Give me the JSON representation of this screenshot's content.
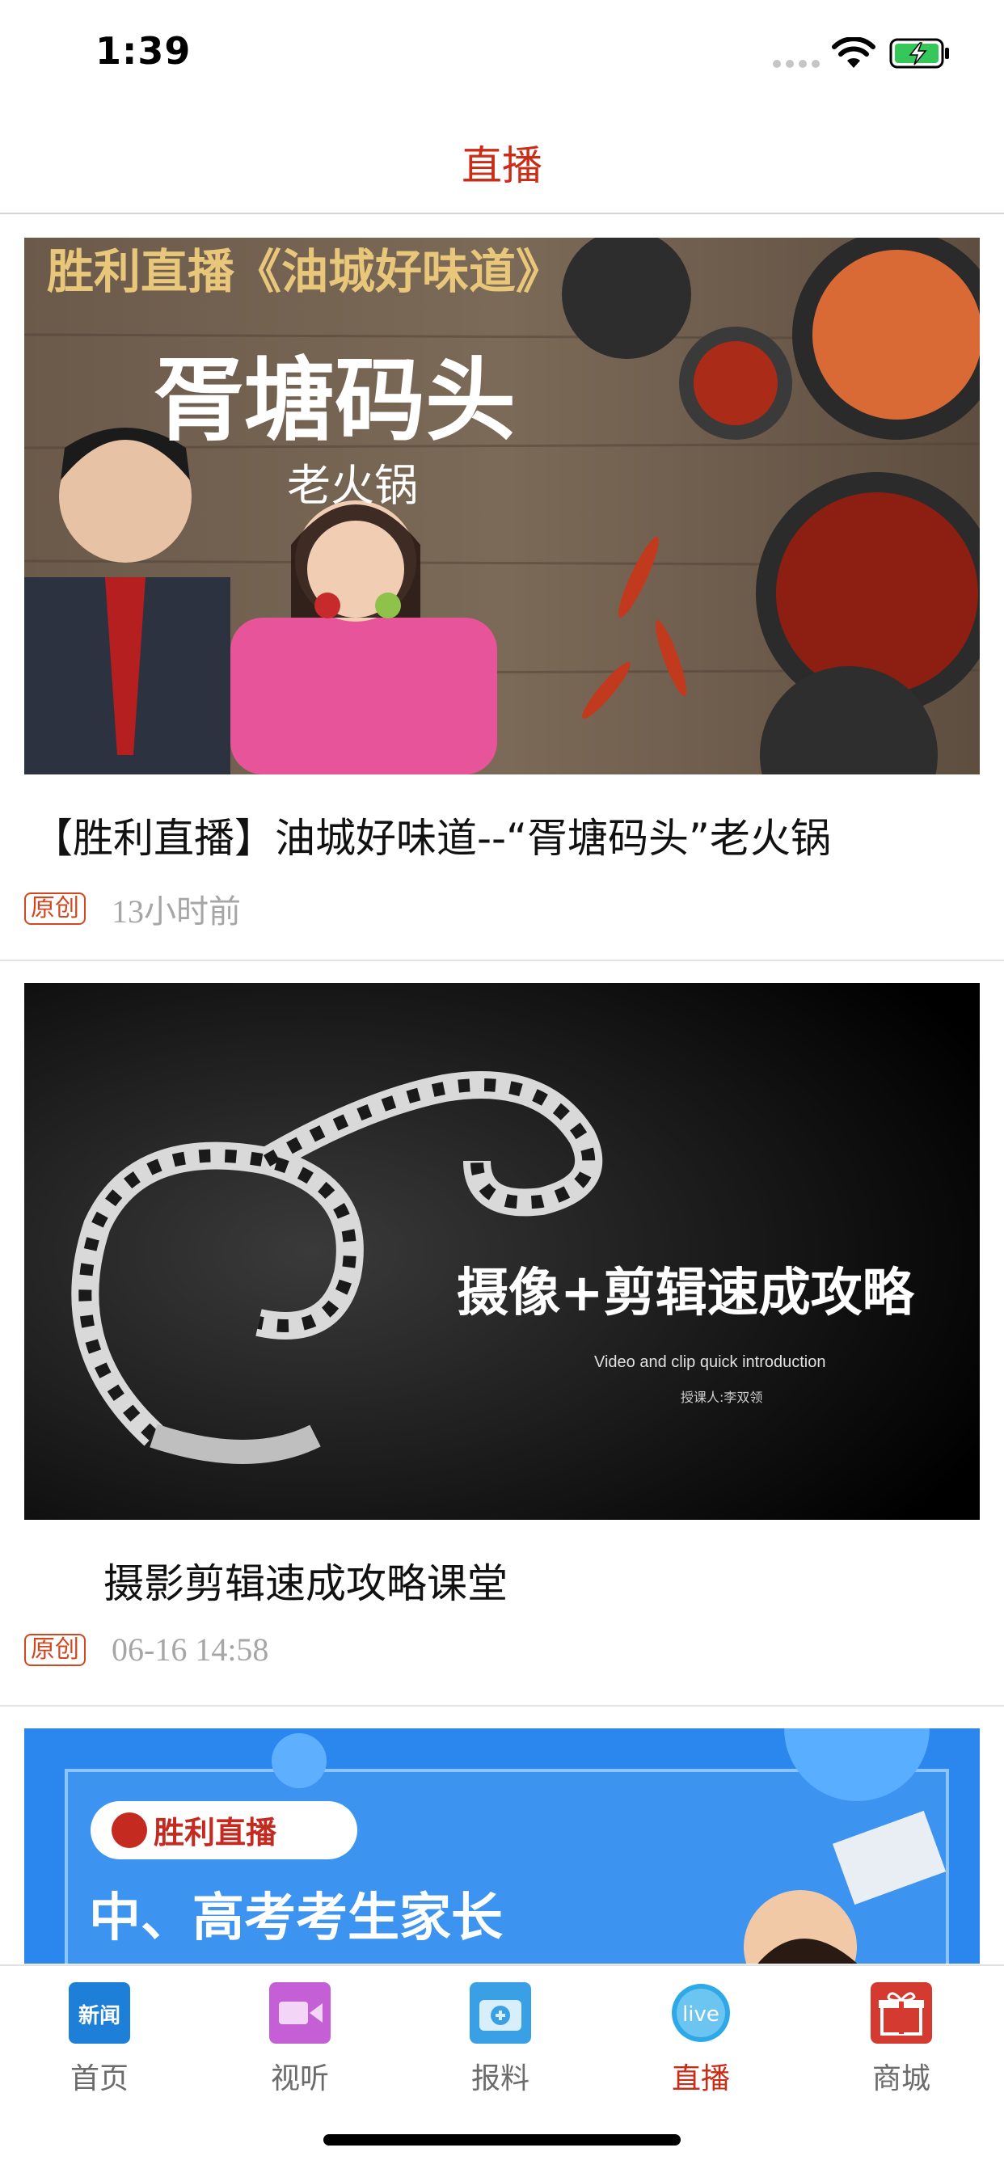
{
  "status_bar": {
    "time": "1:39"
  },
  "header": {
    "title": "直播"
  },
  "feed": [
    {
      "title": "【胜利直播】油城好味道--“胥塘码头”老火锅",
      "badge": "原创",
      "time": "13小时前",
      "image_text": {
        "top": "胜利直播《油城好味道》",
        "brand": "胥塘码头",
        "subtitle": "老火锅"
      }
    },
    {
      "title": "摄影剪辑速成攻略课堂",
      "badge": "原创",
      "time": "06-16 14:58",
      "image_text": {
        "headline": "摄像+剪辑速成攻略",
        "english": "Video and clip quick introduction",
        "lecturer": "授课人:李双领"
      }
    },
    {
      "image_text": {
        "logo": "胜利直播",
        "headline": "中、高考考生家长"
      }
    }
  ],
  "tabbar": {
    "items": [
      {
        "label": "首页",
        "icon": "news-icon",
        "icon_text": "新闻",
        "color": "#1d7fd8"
      },
      {
        "label": "视听",
        "icon": "video-camera-icon",
        "color": "#c55fd6"
      },
      {
        "label": "报料",
        "icon": "camera-icon",
        "color": "#3aa0e6"
      },
      {
        "label": "直播",
        "icon": "live-icon",
        "icon_text": "live",
        "color": "#2ea8e6",
        "active": true
      },
      {
        "label": "商城",
        "icon": "gift-icon",
        "color": "#d43a2f"
      }
    ]
  },
  "colors": {
    "accent": "#cc2b16",
    "badge": "#d4461e",
    "meta": "#a6a6a6"
  }
}
